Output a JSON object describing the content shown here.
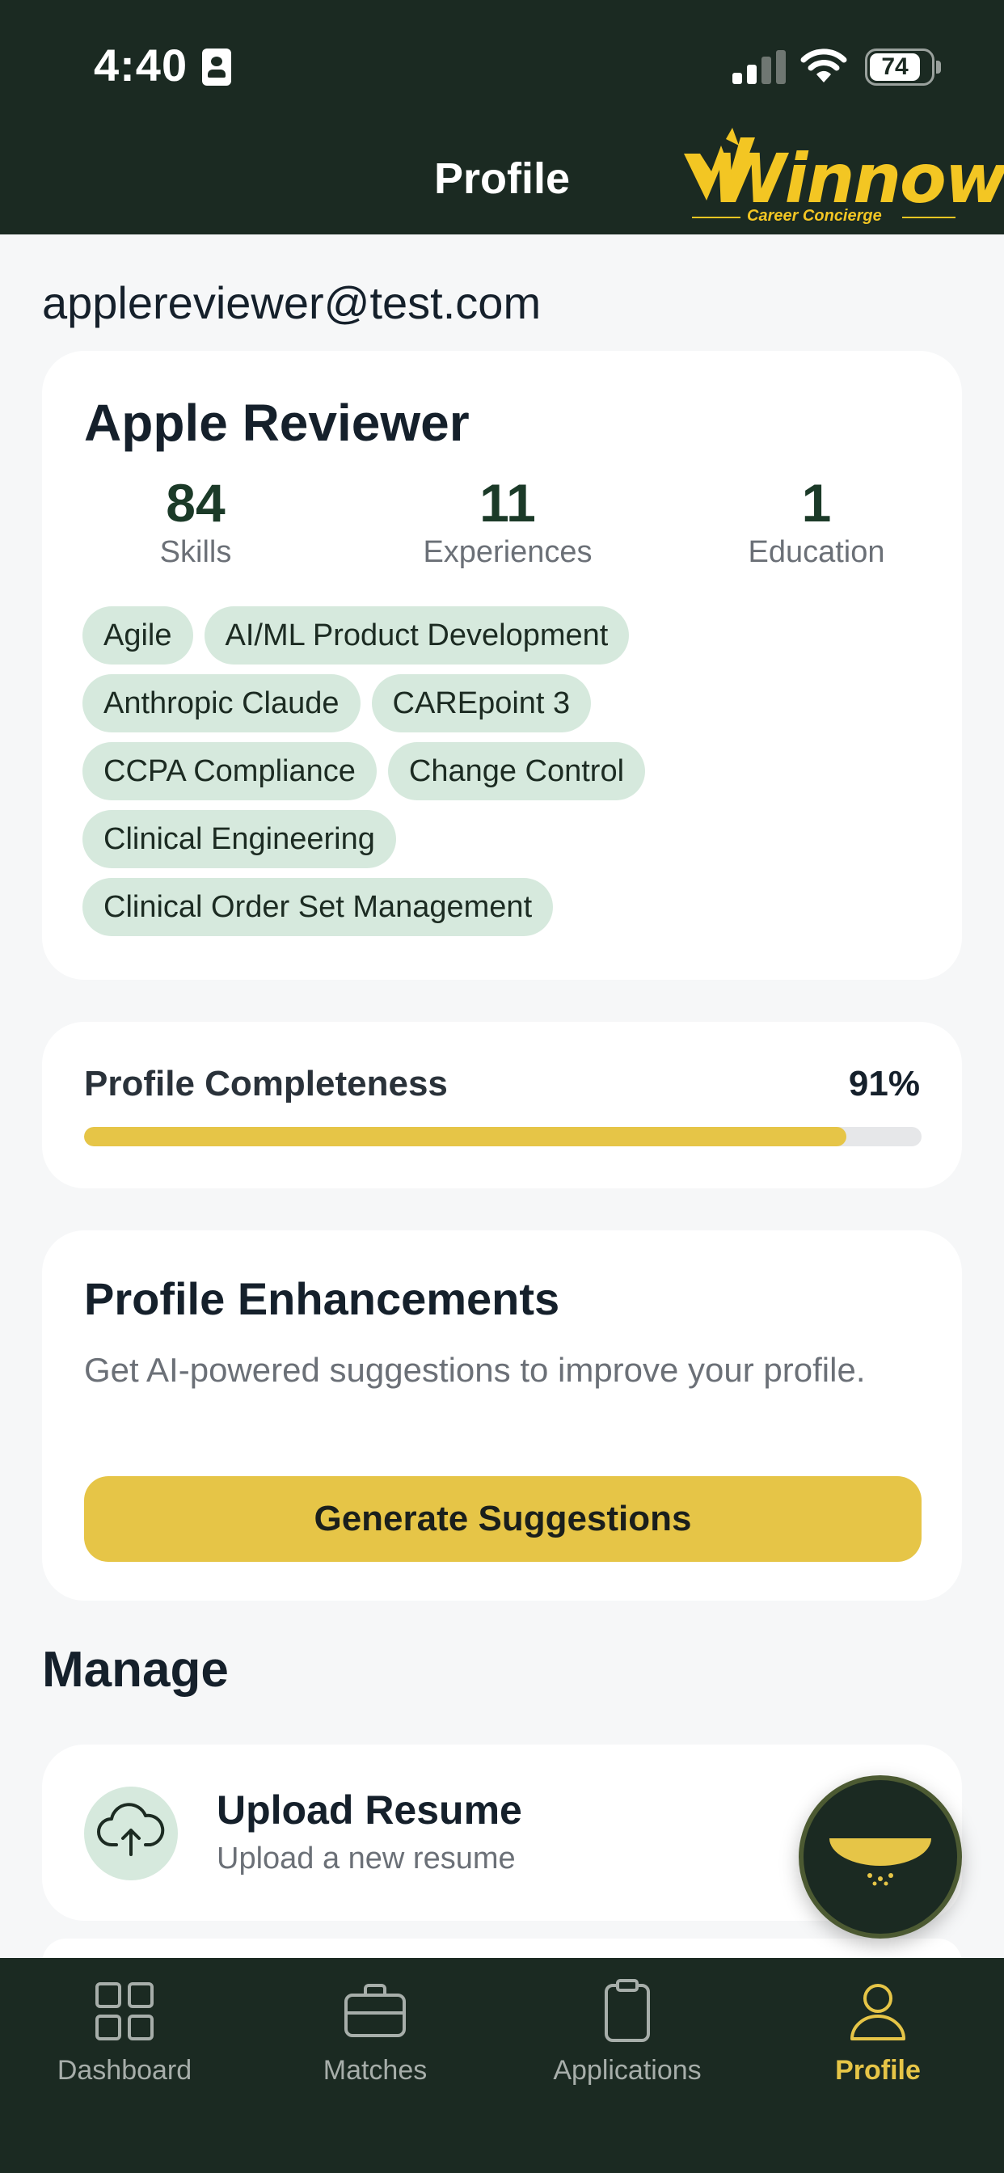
{
  "status_bar": {
    "time": "4:40",
    "battery": "74",
    "icons": [
      "contact-card-icon",
      "cellular-signal-icon",
      "wifi-icon",
      "battery-icon"
    ]
  },
  "header": {
    "title": "Profile",
    "logo_text": "Winnow",
    "logo_tagline": "Career Concierge"
  },
  "email": "applereviewer@test.com",
  "profile": {
    "name": "Apple Reviewer",
    "stats": [
      {
        "value": "84",
        "label": "Skills"
      },
      {
        "value": "11",
        "label": "Experiences"
      },
      {
        "value": "1",
        "label": "Education"
      }
    ],
    "tag_rows": [
      [
        "Agile",
        "AI/ML Product Development"
      ],
      [
        "Anthropic Claude",
        "CAREpoint 3"
      ],
      [
        "CCPA Compliance",
        "Change Control"
      ],
      [
        "Clinical Engineering"
      ],
      [
        "Clinical Order Set Management"
      ]
    ]
  },
  "completeness": {
    "label": "Profile Completeness",
    "value_text": "91%",
    "value": 0.91
  },
  "enhancements": {
    "title": "Profile Enhancements",
    "description": "Get AI-powered suggestions to improve your profile.",
    "button_label": "Generate Suggestions"
  },
  "manage": {
    "heading": "Manage",
    "items": [
      {
        "title": "Upload Resume",
        "subtitle": "Upload a new resume",
        "icon": "cloud-upload-icon"
      }
    ]
  },
  "tabs": [
    {
      "label": "Dashboard",
      "icon": "grid-icon",
      "active": false
    },
    {
      "label": "Matches",
      "icon": "briefcase-icon",
      "active": false
    },
    {
      "label": "Applications",
      "icon": "clipboard-icon",
      "active": false
    },
    {
      "label": "Profile",
      "icon": "person-icon",
      "active": true
    }
  ],
  "colors": {
    "header_bg": "#1b2a22",
    "accent_yellow": "#e6c547",
    "tag_bg": "#d6e9dd",
    "stat_value": "#1b3a28"
  }
}
